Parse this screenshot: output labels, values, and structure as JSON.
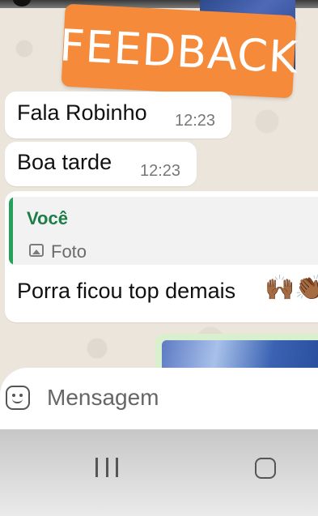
{
  "sticker": {
    "text": "FEEDBACK"
  },
  "messages": [
    {
      "text": "Fala Robinho",
      "time": "12:23"
    },
    {
      "text": "Boa tarde",
      "time": "12:23"
    },
    {
      "quote_author": "Você",
      "quote_label": "Foto",
      "text": "Porra ficou top demais",
      "emoji": "🙌🏾👏🏾"
    }
  ],
  "input": {
    "placeholder": "Mensagem"
  },
  "colors": {
    "sticker": "#f58a3b",
    "quote_bar": "#25a05a",
    "quote_author": "#1d7d46"
  },
  "icons": [
    "sticker-icon",
    "photo-icon",
    "recent-apps-icon",
    "home-icon"
  ]
}
